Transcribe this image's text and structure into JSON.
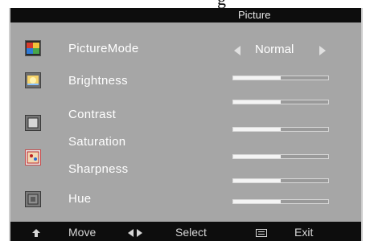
{
  "osd": {
    "title": "Picture",
    "title_partial": "g",
    "items": [
      {
        "label": "PictureMode",
        "icon": "palette-icon"
      },
      {
        "label": "Brightness",
        "icon": "brightness-icon"
      },
      {
        "label": "Contrast",
        "icon": "contrast-icon"
      },
      {
        "label": "Saturation",
        "icon": "saturation-icon"
      },
      {
        "label": "Sharpness",
        "icon": "sharpness-icon"
      },
      {
        "label": "Hue",
        "icon": "hue-icon"
      }
    ],
    "picture_mode_value": "Normal",
    "sliders": [
      {
        "name": "brightness",
        "level": 0.5
      },
      {
        "name": "contrast",
        "level": 0.5
      },
      {
        "name": "saturation",
        "level": 0.5
      },
      {
        "name": "sharpness",
        "level": 0.5
      },
      {
        "name": "hue",
        "level": 0.5
      },
      {
        "name": "extra",
        "level": 0.5
      }
    ],
    "footer": {
      "move_label": "Move",
      "select_label": "Select",
      "exit_label": "Exit"
    },
    "colors": {
      "panel": "#a6a6a6",
      "bar": "#0d0d0d",
      "slider_fill": "#f4f4f4"
    }
  }
}
